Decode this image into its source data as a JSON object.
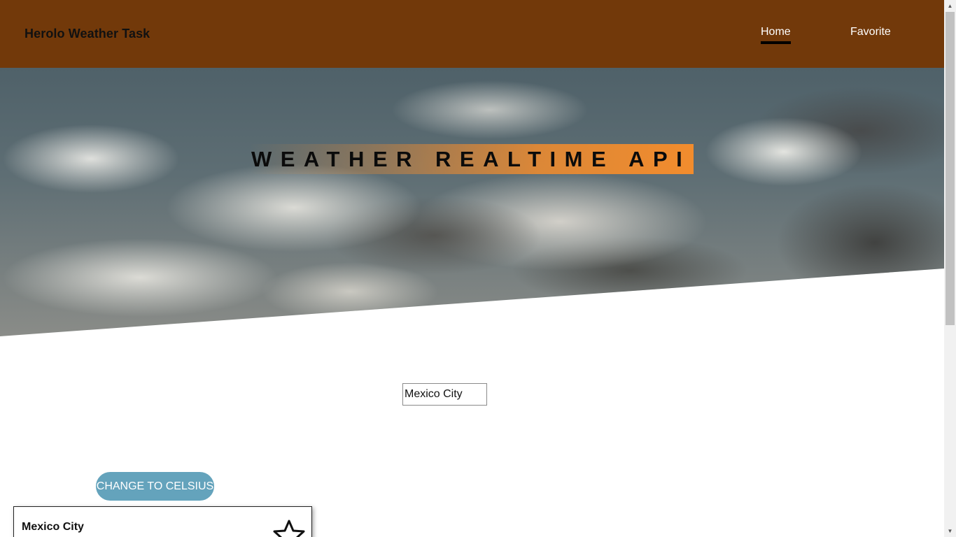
{
  "header": {
    "brand": "Herolo Weather Task",
    "nav": {
      "home": "Home",
      "favorite": "Favorite"
    },
    "background_color": "#72390a"
  },
  "hero": {
    "title": "WEATHER REALTIME API",
    "highlight_color": "#f28c2d"
  },
  "search": {
    "value": "Mexico City"
  },
  "toggle_button": {
    "label": "CHANGE TO CELSIUS",
    "color": "#64a3bc"
  },
  "weather_card": {
    "city": "Mexico City",
    "favorite_icon": "star-outline-icon"
  }
}
